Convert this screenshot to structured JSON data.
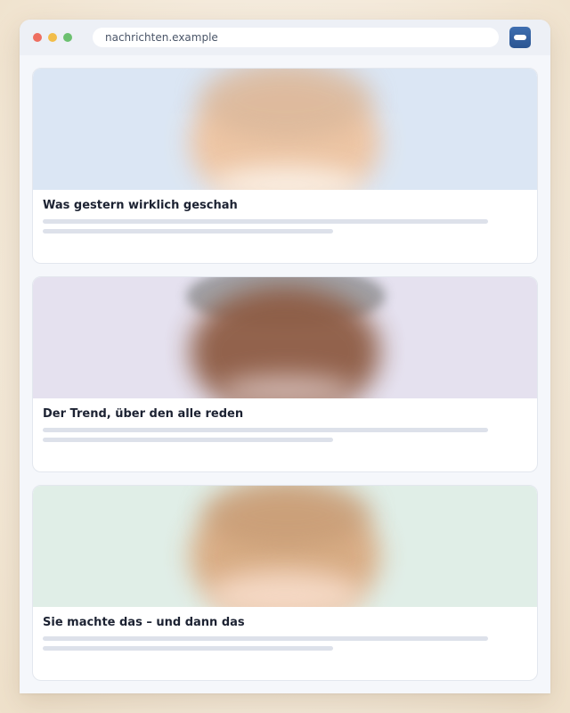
{
  "browser": {
    "url": "nachrichten.example",
    "window_controls": [
      "close",
      "minimize",
      "maximize"
    ],
    "control_colors": {
      "close": "#ee6e60",
      "minimize": "#f2bd4a",
      "maximize": "#6cc070"
    },
    "extension_icon": "toggle-icon"
  },
  "articles": [
    {
      "title": "Was gestern wirklich geschah",
      "thumbnail_bg": "#dbe6f4"
    },
    {
      "title": "Der Trend, über den alle reden",
      "thumbnail_bg": "#e5e1ef"
    },
    {
      "title": "Sie machte das – und dann das",
      "thumbnail_bg": "#e0eee7"
    }
  ]
}
